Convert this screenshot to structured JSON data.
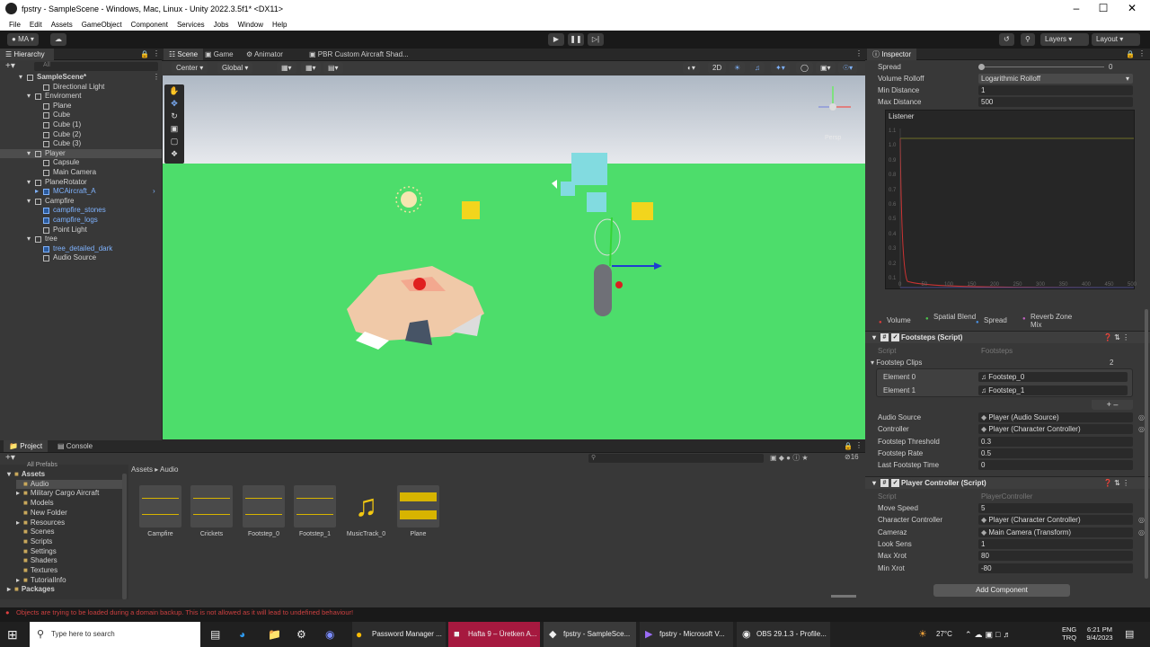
{
  "window": {
    "title": "fpstry - SampleScene - Windows, Mac, Linux - Unity 2022.3.5f1* <DX11>"
  },
  "menu": [
    "File",
    "Edit",
    "Assets",
    "GameObject",
    "Component",
    "Services",
    "Jobs",
    "Window",
    "Help"
  ],
  "toolbar": {
    "account": "MA",
    "layers": "Layers",
    "layout": "Layout"
  },
  "hierarchy": {
    "title": "Hierarchy",
    "search_placeholder": "All",
    "items": [
      {
        "label": "SampleScene*",
        "indent": 0
      },
      {
        "label": "Directional Light",
        "indent": 2
      },
      {
        "label": "Enviroment",
        "indent": 1
      },
      {
        "label": "Plane",
        "indent": 2
      },
      {
        "label": "Cube",
        "indent": 2
      },
      {
        "label": "Cube (1)",
        "indent": 2
      },
      {
        "label": "Cube (2)",
        "indent": 2
      },
      {
        "label": "Cube (3)",
        "indent": 2
      },
      {
        "label": "Player",
        "indent": 1
      },
      {
        "label": "Capsule",
        "indent": 2
      },
      {
        "label": "Main Camera",
        "indent": 2
      },
      {
        "label": "PlaneRotator",
        "indent": 1
      },
      {
        "label": "MCAircraft_A",
        "indent": 2
      },
      {
        "label": "Campfire",
        "indent": 1
      },
      {
        "label": "campfire_stones",
        "indent": 2
      },
      {
        "label": "campfire_logs",
        "indent": 2
      },
      {
        "label": "Point Light",
        "indent": 2
      },
      {
        "label": "tree",
        "indent": 1
      },
      {
        "label": "tree_detailed_dark",
        "indent": 2
      },
      {
        "label": "Audio Source",
        "indent": 2
      }
    ]
  },
  "tabs": {
    "scene": "Scene",
    "game": "Game",
    "animator": "Animator",
    "shader": "PBR Custom Aircraft Shad...",
    "project": "Project",
    "console": "Console",
    "inspector": "Inspector"
  },
  "scene_toolbar": {
    "pivot": "Center",
    "space": "Global",
    "mode2d": "2D",
    "persp": "Persp"
  },
  "project": {
    "breadcrumb": [
      "Assets",
      "Audio"
    ],
    "badge": "16",
    "tree_top": "All Prefabs",
    "tree": [
      "Assets",
      "Audio",
      "Military Cargo Aircraft",
      "Models",
      "New Folder",
      "Resources",
      "Scenes",
      "Scripts",
      "Settings",
      "Shaders",
      "Textures",
      "TutorialInfo",
      "Packages"
    ],
    "assets": [
      "Campfire",
      "Crickets",
      "Footstep_0",
      "Footstep_1",
      "MusicTrack_0",
      "Plane"
    ]
  },
  "inspector": {
    "audio_rows": [
      {
        "label": "Spread",
        "value": "0"
      },
      {
        "label": "Volume Rolloff",
        "value": "Logarithmic Rolloff"
      },
      {
        "label": "Min Distance",
        "value": "1"
      },
      {
        "label": "Max Distance",
        "value": "500"
      }
    ],
    "listener": "Listener",
    "graph_y": [
      "1.1",
      "1.0",
      "0.9",
      "0.8",
      "0.7",
      "0.6",
      "0.5",
      "0.4",
      "0.3",
      "0.2",
      "0.1"
    ],
    "graph_x": [
      "0",
      "50",
      "100",
      "150",
      "200",
      "250",
      "300",
      "350",
      "400",
      "450",
      "500"
    ],
    "legend": [
      "Volume",
      "Spatial Blend",
      "Spread",
      "Reverb Zone Mix"
    ],
    "legend_colors": [
      "#e03b3b",
      "#4cc44c",
      "#4a90e2",
      "#c060c0"
    ],
    "footsteps": {
      "title": "Footsteps (Script)",
      "script": "Footsteps",
      "clips_label": "Footstep Clips",
      "clips_count": "2",
      "elements": [
        {
          "label": "Element 0",
          "value": "Footstep_0"
        },
        {
          "label": "Element 1",
          "value": "Footstep_1"
        }
      ],
      "fields": [
        {
          "label": "Audio Source",
          "value": "Player (Audio Source)"
        },
        {
          "label": "Controller",
          "value": "Player (Character Controller)"
        },
        {
          "label": "Footstep Threshold",
          "value": "0.3"
        },
        {
          "label": "Footstep Rate",
          "value": "0.5"
        },
        {
          "label": "Last Footstep Time",
          "value": "0"
        }
      ]
    },
    "player_controller": {
      "title": "Player Controller (Script)",
      "script": "PlayerController",
      "fields": [
        {
          "label": "Move Speed",
          "value": "5"
        },
        {
          "label": "Character Controller",
          "value": "Player (Character Controller)"
        },
        {
          "label": "Cameraz",
          "value": "Main Camera (Transform)"
        },
        {
          "label": "Look Sens",
          "value": "1"
        },
        {
          "label": "Max Xrot",
          "value": "80"
        },
        {
          "label": "Min Xrot",
          "value": "-80"
        }
      ]
    },
    "add_component": "Add Component"
  },
  "status": "Objects are trying to be loaded during a domain backup. This is not allowed as it will lead to undefined behaviour!",
  "taskbar": {
    "search": "Type here to search",
    "apps": [
      "Password Manager ...",
      "Hafta 9 – Üretken A...",
      "fpstry - SampleSce...",
      "fpstry - Microsoft V...",
      "OBS 29.1.3 - Profile..."
    ],
    "temp": "27°C",
    "lang1": "ENG",
    "lang2": "TRQ",
    "time": "6:21 PM",
    "date": "9/4/2023"
  }
}
